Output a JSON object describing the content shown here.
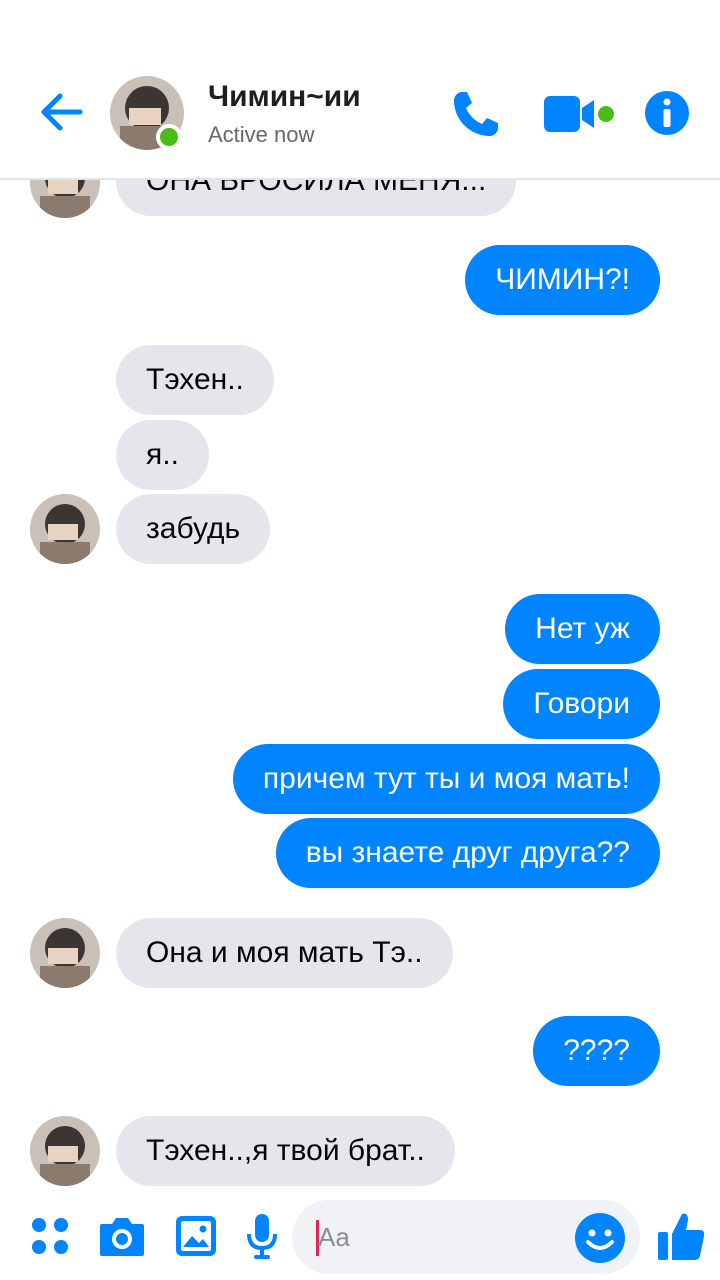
{
  "header": {
    "contact_name": "Чимин~ии",
    "status": "Active now",
    "icons": [
      "back-arrow-icon",
      "phone-icon",
      "video-camera-icon",
      "info-icon"
    ],
    "online": true
  },
  "messages": [
    {
      "side": "in",
      "text": "ОНА БРОСИЛА МЕНЯ...",
      "avatar": true
    },
    {
      "side": "out",
      "text": "ЧИМИН?!"
    },
    {
      "side": "in",
      "text": "Тэхен..",
      "avatar": false
    },
    {
      "side": "in",
      "text": "я..",
      "avatar": false
    },
    {
      "side": "in",
      "text": "забудь",
      "avatar": true
    },
    {
      "side": "out",
      "text": "Нет уж"
    },
    {
      "side": "out",
      "text": "Говори"
    },
    {
      "side": "out",
      "text": "причем тут ты и моя мать!"
    },
    {
      "side": "out",
      "text": "вы знаете друг друга??"
    },
    {
      "side": "in",
      "text": "Она и моя мать Тэ..",
      "avatar": true
    },
    {
      "side": "out",
      "text": "????"
    },
    {
      "side": "in",
      "text": "Тэхен..,я твой брат..",
      "avatar": true
    }
  ],
  "composer": {
    "placeholder": "Aa",
    "icons": [
      "menu-dots-icon",
      "camera-icon",
      "image-icon",
      "microphone-icon",
      "emoji-icon",
      "thumbs-up-icon"
    ]
  },
  "colors": {
    "accent": "#0084ff",
    "incoming_bubble": "#e4e6eb",
    "online": "#4cbb17"
  }
}
